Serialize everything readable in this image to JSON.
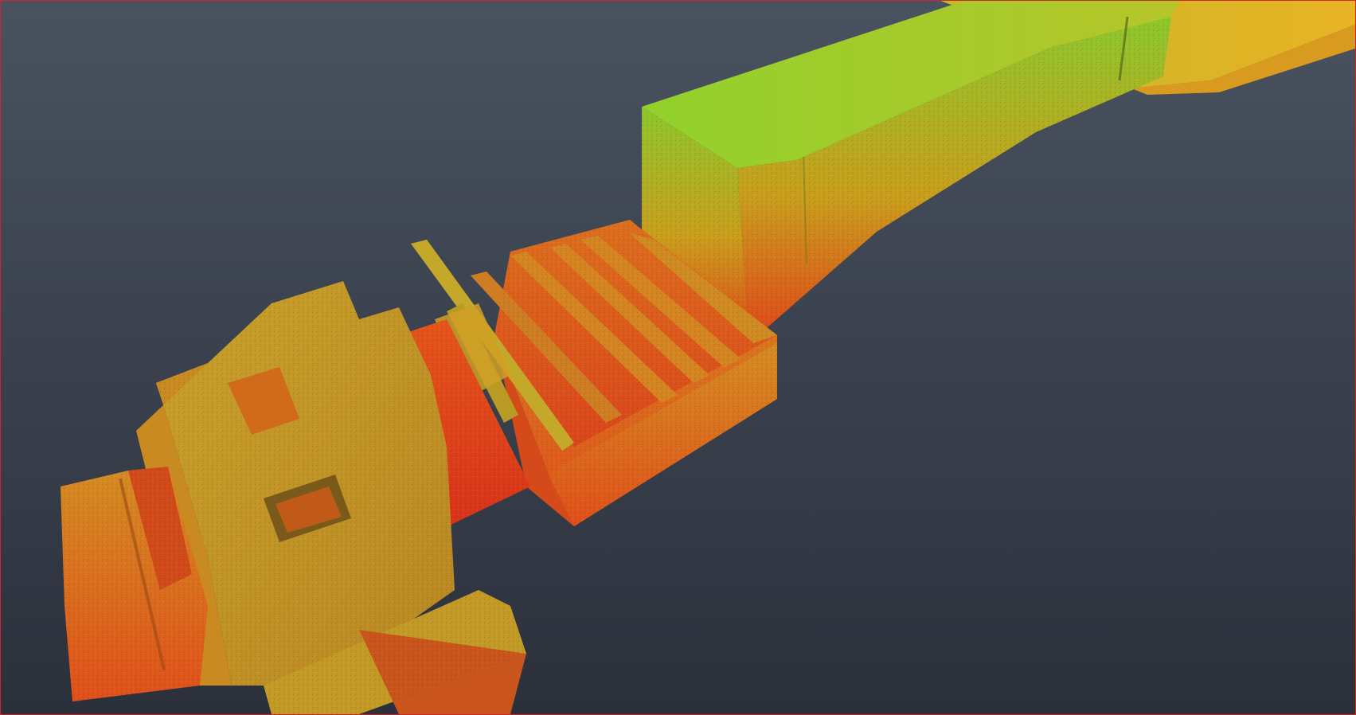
{
  "viewer": {
    "view_type": "3d-point-cloud",
    "color_mode": "height-ramp",
    "border_color": "#d0242c",
    "background_top": "#4a5260",
    "background_bottom": "#2b303b",
    "scalar_colors": {
      "low": "#e53a12",
      "mid": "#c98a1c",
      "high": "#8fd22b"
    }
  }
}
